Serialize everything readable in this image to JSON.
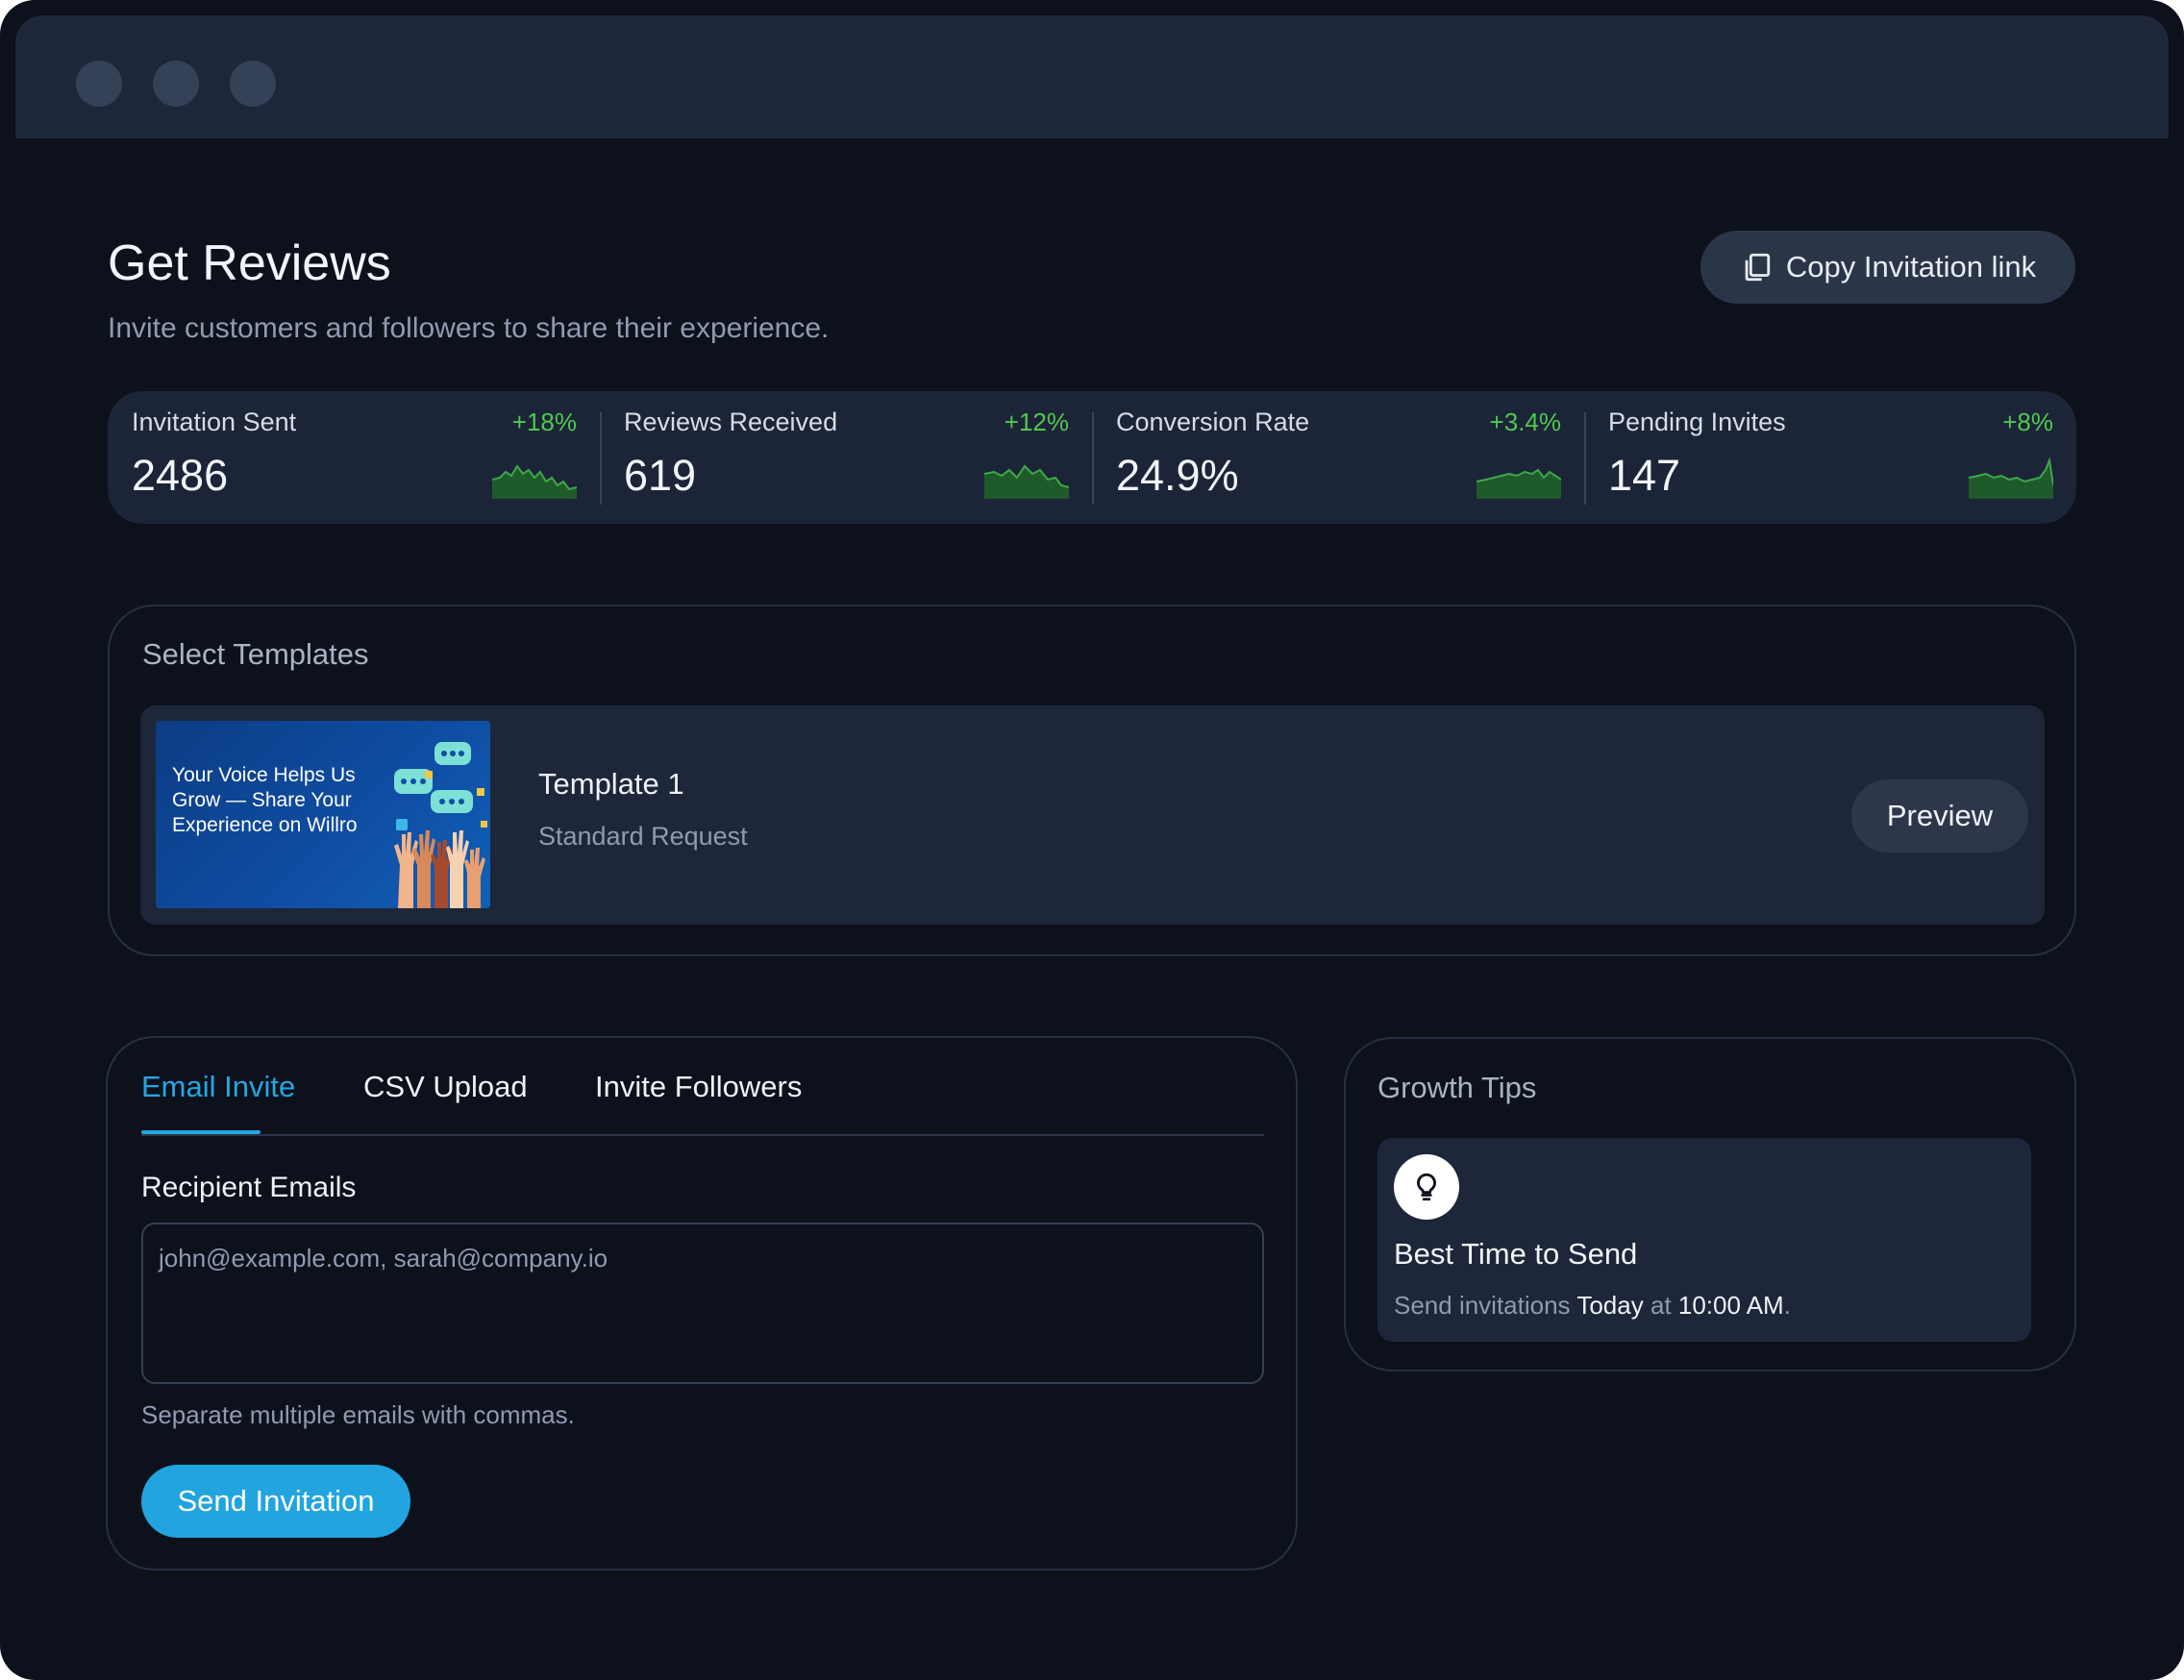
{
  "header": {
    "title": "Get Reviews",
    "subtitle": "Invite customers and followers to share their experience.",
    "copy_button_label": "Copy Invitation link",
    "copy_icon": "copy-icon"
  },
  "stats": [
    {
      "label": "Invitation Sent",
      "value": "2486",
      "change": "+18%",
      "trend_color": "#4fc84f"
    },
    {
      "label": "Reviews Received",
      "value": "619",
      "change": "+12%",
      "trend_color": "#4fc84f"
    },
    {
      "label": "Conversion Rate",
      "value": "24.9%",
      "change": "+3.4%",
      "trend_color": "#4fc84f"
    },
    {
      "label": "Pending Invites",
      "value": "147",
      "change": "+8%",
      "trend_color": "#4fc84f"
    }
  ],
  "templates": {
    "section_title": "Select Templates",
    "items": [
      {
        "thumbnail_text": "Your Voice Helps Us Grow — Share Your Experience on Willro",
        "name": "Template 1",
        "description": "Standard Request",
        "preview_label": "Preview"
      }
    ]
  },
  "invite": {
    "tabs": [
      {
        "label": "Email Invite",
        "active": true
      },
      {
        "label": "CSV Upload",
        "active": false
      },
      {
        "label": "Invite Followers",
        "active": false
      }
    ],
    "field_label": "Recipient Emails",
    "placeholder": "john@example.com, sarah@company.io",
    "hint": "Separate multiple emails with commas.",
    "send_label": "Send Invitation"
  },
  "tips": {
    "section_title": "Growth Tips",
    "card_title": "Best Time to Send",
    "icon": "lightbulb-icon",
    "body_prefix": "Send invitations ",
    "body_day": "Today",
    "body_mid": " at ",
    "body_time": "10:00 AM",
    "body_suffix": "."
  },
  "colors": {
    "accent": "#22a4df",
    "positive": "#4fc84f",
    "background": "#0c111c",
    "card": "#1d2739"
  }
}
